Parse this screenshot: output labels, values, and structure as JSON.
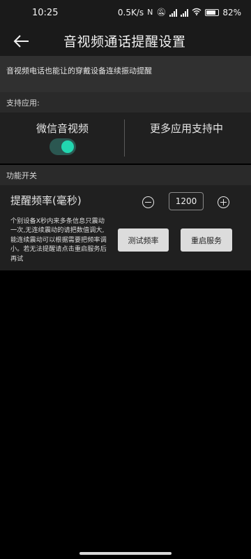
{
  "status_bar": {
    "time": "10:25",
    "net_speed": "0.5K/s",
    "battery": "82%",
    "icons": [
      "nfc-icon",
      "mute-icon",
      "signal-icon",
      "signal-icon",
      "wifi-icon",
      "battery-icon"
    ]
  },
  "app_bar": {
    "back_icon": "arrow-left-icon",
    "title": "音视频通话提醒设置"
  },
  "description": "音视频电话也能让的穿戴设备连续振动提醒",
  "supported_apps": {
    "header": "支持应用:",
    "wechat_label": "微信音视频",
    "wechat_enabled": true,
    "more_apps_label": "更多应用支持中",
    "accent_color": "#22d7b0"
  },
  "functions": {
    "header": "功能开关",
    "frequency_label": "提醒频率(毫秒)",
    "frequency_value": "1200",
    "help_text": "个别设备X秒内来多条信息只震动一次,无连续震动的请把数值调大, 能连续震动可以根据需要把频率调小。若无法提醒请点击重启服务后再试",
    "test_button": "测试频率",
    "restart_button": "重启服务"
  }
}
